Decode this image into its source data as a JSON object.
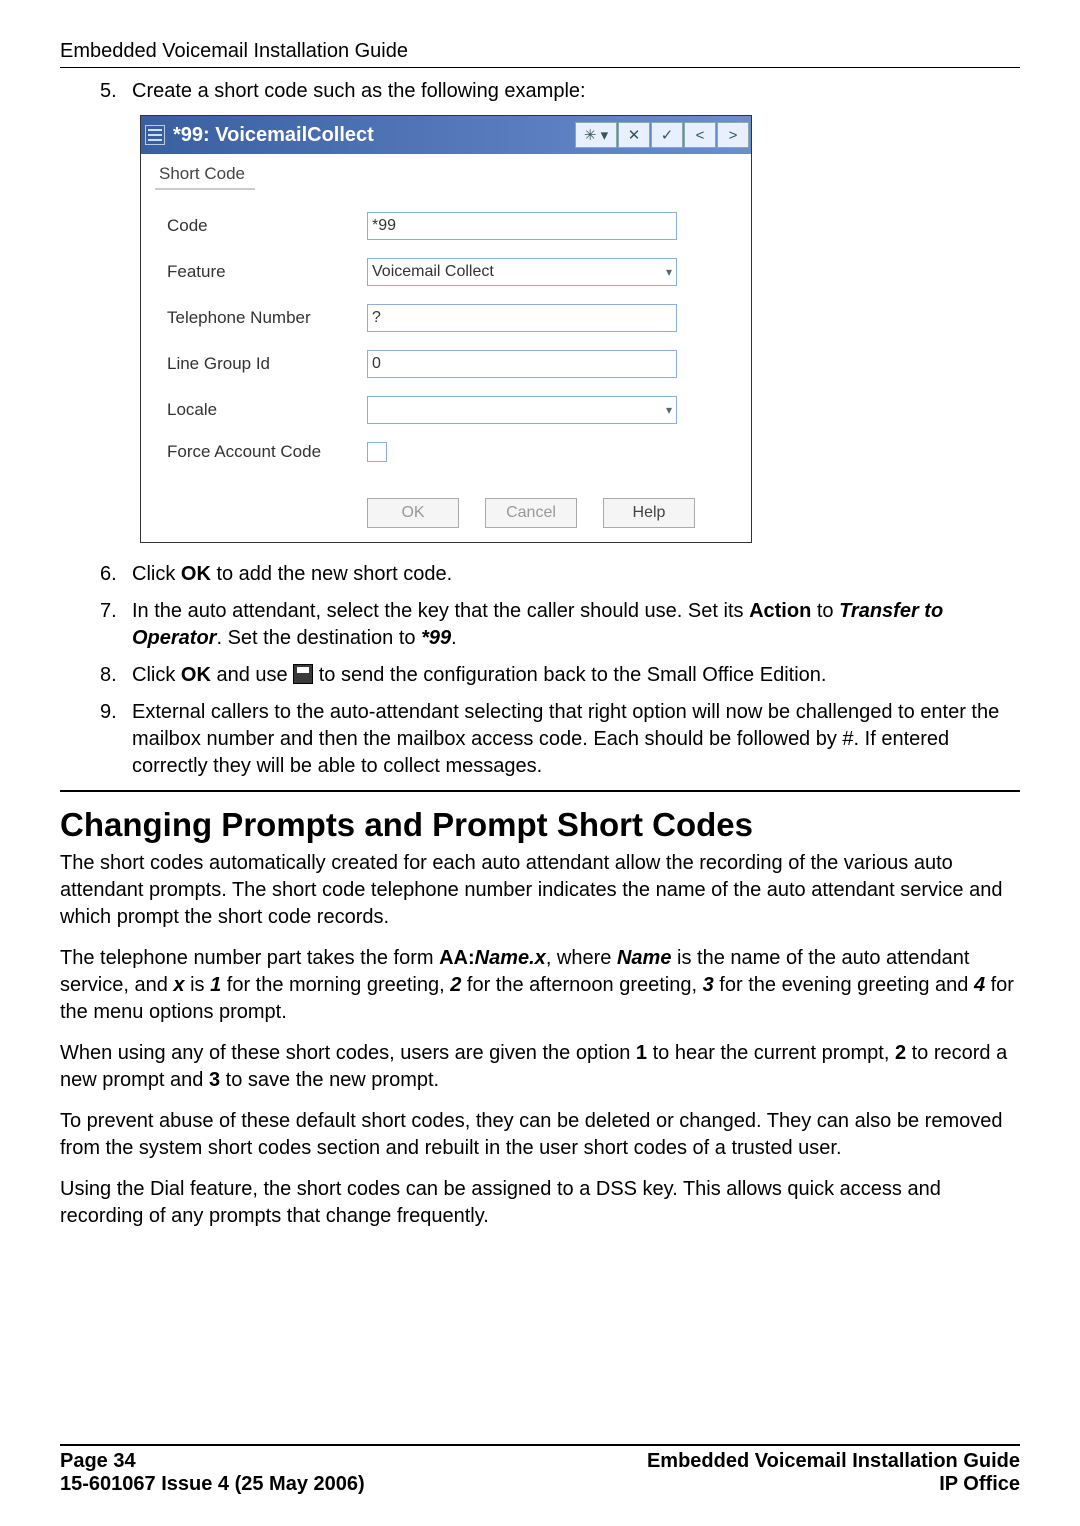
{
  "header": {
    "title": "Embedded Voicemail Installation Guide"
  },
  "step5": {
    "num": "5.",
    "text": "Create a short code such as the following example:"
  },
  "dialog": {
    "title": "*99: VoicemailCollect",
    "tab": "Short Code",
    "fields": {
      "code_label": "Code",
      "code_value": "*99",
      "feature_label": "Feature",
      "feature_value": "Voicemail Collect",
      "tel_label": "Telephone Number",
      "tel_value": "?",
      "lgid_label": "Line Group Id",
      "lgid_value": "0",
      "locale_label": "Locale",
      "locale_value": "",
      "fac_label": "Force Account Code"
    },
    "buttons": {
      "ok": "OK",
      "cancel": "Cancel",
      "help": "Help"
    },
    "tb_icons": {
      "new": "✳",
      "dd": "▾",
      "close": "✕",
      "check": "✓",
      "prev": "<",
      "next": ">"
    }
  },
  "step6": {
    "num": "6.",
    "pre": "Click ",
    "b1": "OK",
    "post": " to add the new short code."
  },
  "step7": {
    "num": "7.",
    "pre": "In the auto attendant, select the key that the caller should use. Set its ",
    "b1": "Action",
    "mid1": " to ",
    "bi1": "Transfer to Operator",
    "mid2": ". Set the destination to ",
    "bi2": "*99",
    "post": "."
  },
  "step8": {
    "num": "8.",
    "pre": "Click ",
    "b1": "OK",
    "mid": " and use ",
    "post": " to send the configuration back to the Small Office Edition."
  },
  "step9": {
    "num": "9.",
    "text": "External callers to the auto-attendant selecting that right option will now be challenged to enter the mailbox number and then the mailbox access code. Each should be followed by #. If entered correctly they will be able to collect messages."
  },
  "section": "Changing Prompts and Prompt Short Codes",
  "p1": "The short codes automatically created for each auto attendant allow the recording of the various auto attendant prompts. The short code telephone number indicates the name of the auto attendant service and which prompt the short code records.",
  "p2": {
    "pre": "The telephone number part takes the form ",
    "b1": "AA:",
    "bi1": "Name.x",
    "mid1": ", where ",
    "bi2": "Name",
    "mid2": " is the name of the auto attendant service, and ",
    "bi3": "x",
    "mid3": " is ",
    "bi4": "1",
    "mid4": " for the morning greeting, ",
    "bi5": "2",
    "mid5": " for the afternoon greeting, ",
    "bi6": "3",
    "mid6": " for the evening greeting and ",
    "bi7": "4",
    "post": " for the menu options prompt."
  },
  "p3": {
    "pre": "When using any of these short codes, users are given the option ",
    "b1": "1",
    "mid1": " to hear the current prompt, ",
    "b2": "2",
    "mid2": " to record a new prompt and ",
    "b3": "3",
    "post": " to save the new prompt."
  },
  "p4": "To prevent abuse of these default short codes, they can be deleted or changed. They can also be removed from the system short codes section and rebuilt in the user short codes of a trusted user.",
  "p5": "Using the Dial feature, the short codes can be assigned to a DSS key. This allows quick access and recording of any prompts that change frequently.",
  "footer": {
    "page": "Page 34",
    "issue": "15-601067 Issue 4 (25 May 2006)",
    "right1": "Embedded Voicemail Installation Guide",
    "right2": "IP Office"
  }
}
